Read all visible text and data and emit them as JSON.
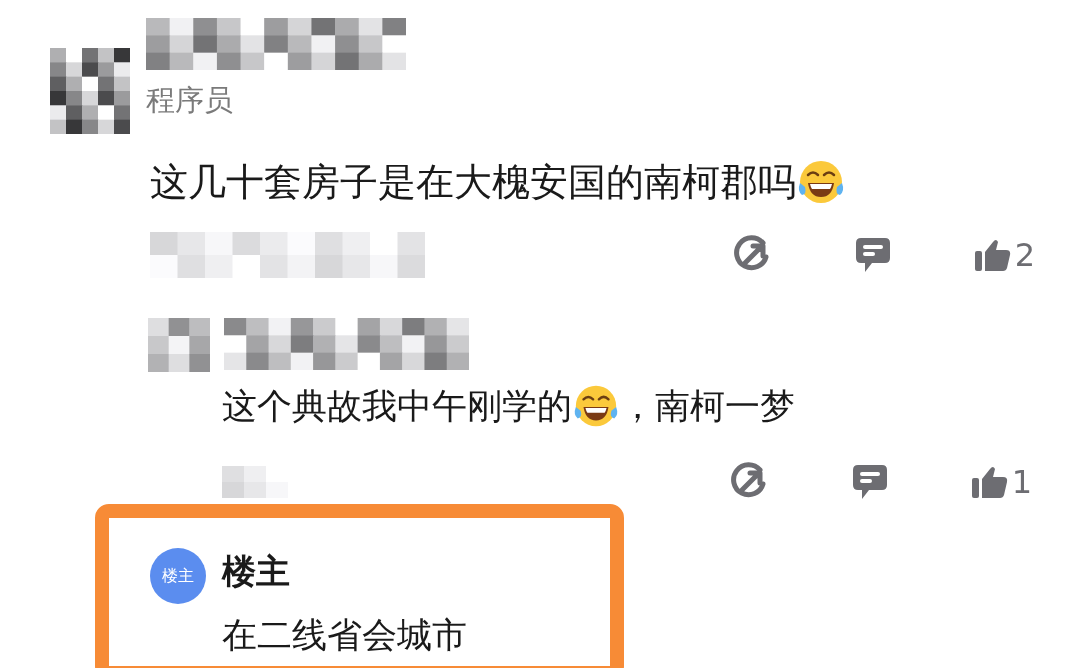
{
  "comment": {
    "author_title": "程序员",
    "segments": [
      {
        "kind": "text",
        "text": "这几十套房子是在大槐安国的南柯郡吗"
      },
      {
        "kind": "emoji"
      }
    ],
    "likes": "2"
  },
  "reply": {
    "segments": [
      {
        "kind": "text",
        "text": "这个典故我中午刚学的"
      },
      {
        "kind": "emoji"
      },
      {
        "kind": "text",
        "text": "，南柯一梦"
      }
    ],
    "likes": "1"
  },
  "highlight": {
    "badge": "楼主",
    "name": "楼主",
    "text": "在二线省会城市"
  }
}
